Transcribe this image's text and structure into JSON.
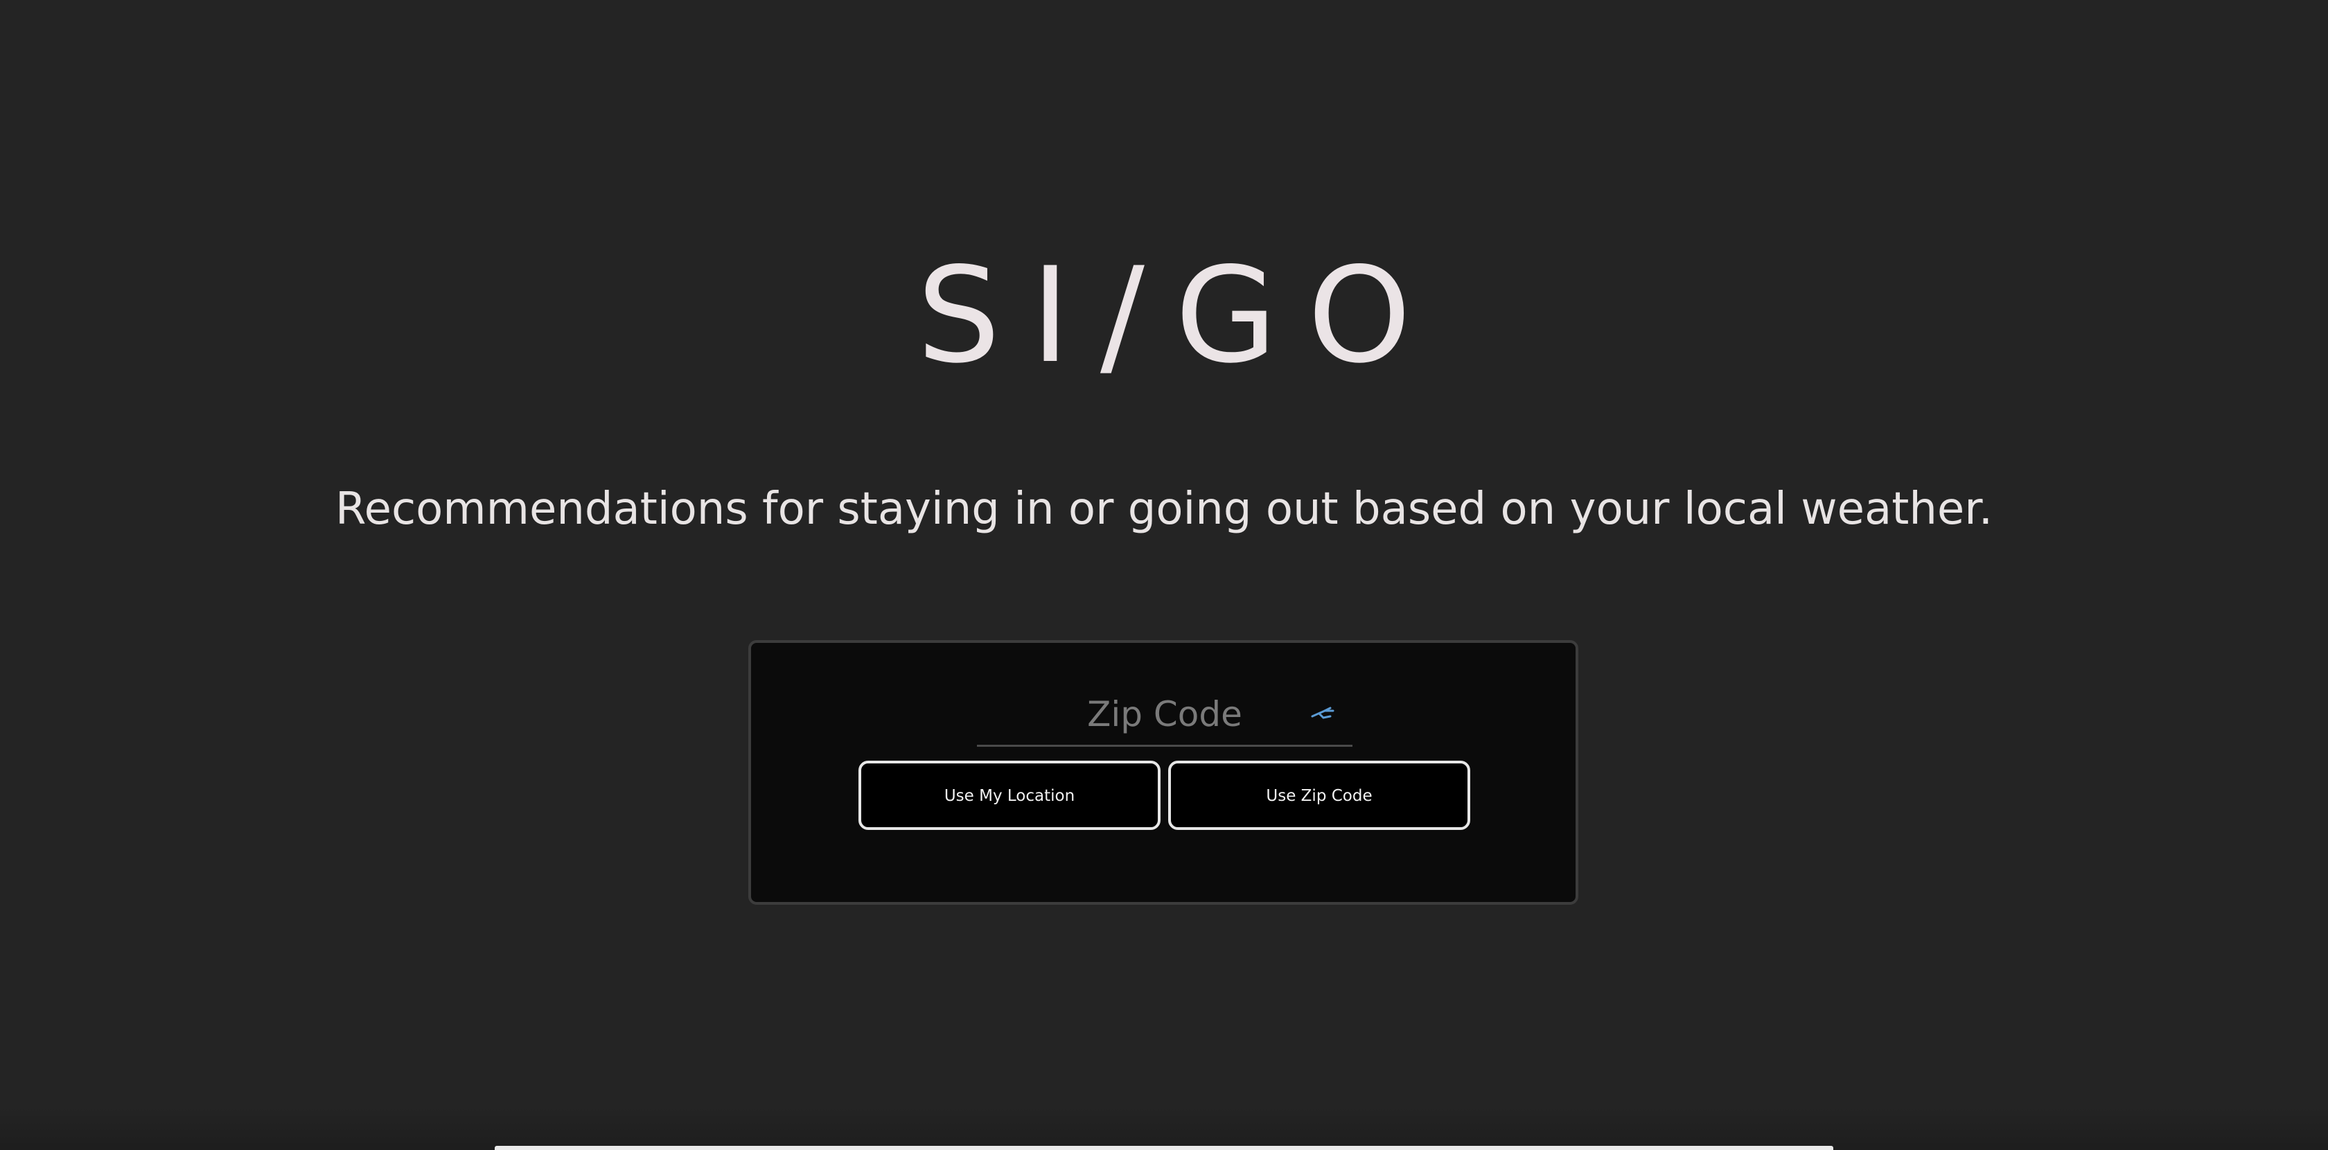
{
  "header": {
    "logo": "SI/GO",
    "tagline": "Recommendations for staying in or going out based on your local weather."
  },
  "form": {
    "zip": {
      "placeholder": "Zip Code",
      "value": "",
      "icon": "autofill-key-icon",
      "icon_color": "#5b9bd5"
    },
    "buttons": {
      "location_label": "Use My Location",
      "zip_label": "Use Zip Code"
    }
  },
  "colors": {
    "background": "#242424",
    "card": "#0b0b0b",
    "text": "#ebe4e6"
  }
}
